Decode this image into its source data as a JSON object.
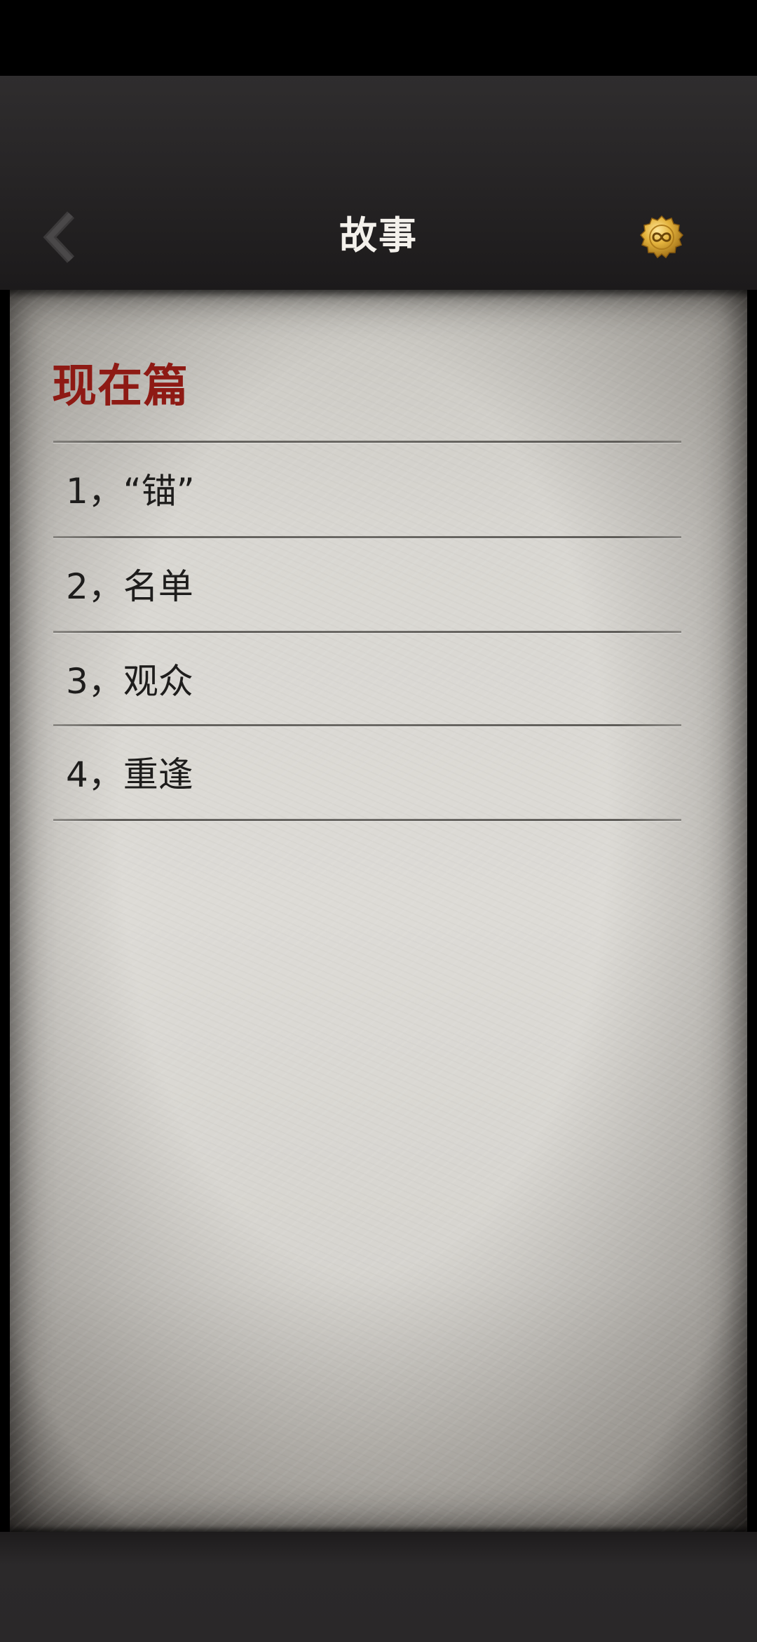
{
  "header": {
    "title": "故事",
    "back_icon": "chevron-left-icon",
    "medal_icon": "infinity-medal-icon"
  },
  "section": {
    "title": "现在篇",
    "title_color": "#8e1a14"
  },
  "chapters": [
    {
      "label": "1，“锚”"
    },
    {
      "label": "2，名单"
    },
    {
      "label": "3，观众"
    },
    {
      "label": "4，重逢"
    }
  ]
}
